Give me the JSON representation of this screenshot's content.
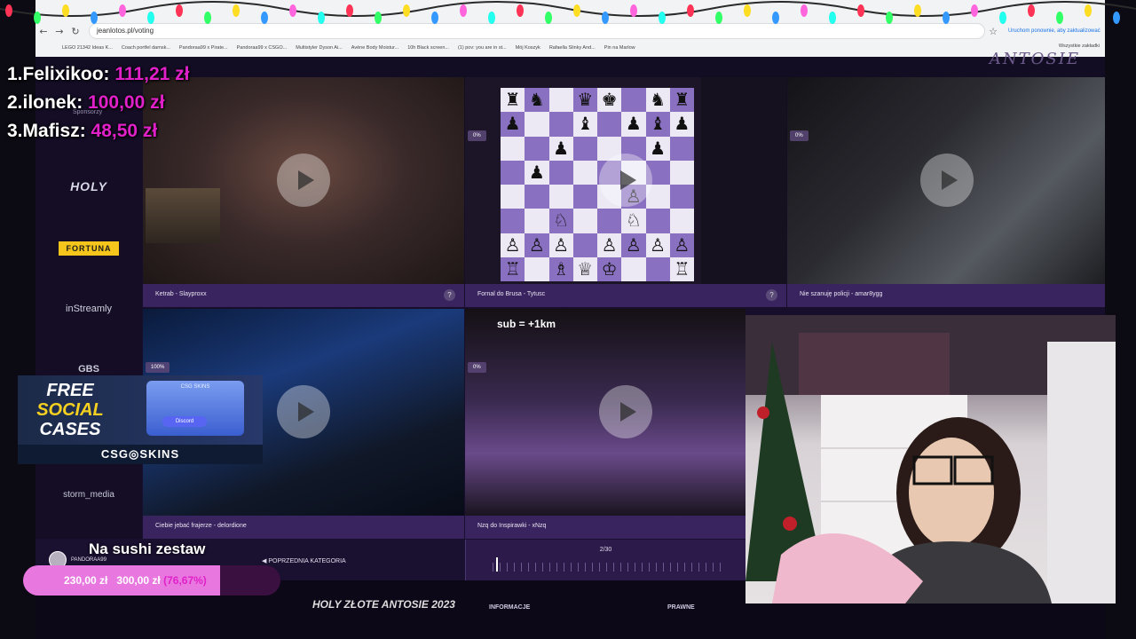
{
  "browser": {
    "url": "jeanlotos.pl/voting",
    "update_note": "Uruchom ponownie, aby zaktualizować",
    "all_bookmarks": "Wszystkie zakładki",
    "bookmarks": [
      "LEGO 21342 Ideas K...",
      "Coach portfel damsk...",
      "Pandoraa99 x Pirate...",
      "Pandoraa99 x CSGO...",
      "Multistyler Dyson Ai...",
      "Avène Body Moistur...",
      "10h Black screen...",
      "(1) pov: you are in st...",
      "Mój Koszyk",
      "Rafaella Slinky And...",
      "Pin na Marlow"
    ]
  },
  "site": {
    "brand_top": "ANTOSIE",
    "sponsors_heading": "Sponsorzy",
    "sponsors": {
      "holy": "HOLY",
      "fortuna": "FORTUNA",
      "instreamly": "inStreamly",
      "gbs": "GBS",
      "storm": "storm_media"
    },
    "tiles": [
      {
        "caption": "Ketrab - Slayproxx",
        "badge": ""
      },
      {
        "caption": "Fornal do Brusa - Tytusc",
        "badge": "0%"
      },
      {
        "caption": "Nie szanuję policji - amar8ygg",
        "badge": "0%"
      },
      {
        "caption": "Ciebie jebać frajerze - delordione",
        "badge": "100%"
      },
      {
        "caption": "Nzq do Inspirawki - xNzq",
        "badge": "0%",
        "overlay": "sub = +1km"
      }
    ],
    "prev_category": "POPRZEDNIA KATEGORIA",
    "page_indicator": "2/30",
    "footer": {
      "logo": "HOLY ZŁOTE ANTOSIE 2023",
      "info": "INFORMACJE",
      "legal": "PRAWNE"
    }
  },
  "leaderboard": [
    {
      "rank": "1.",
      "name": "Felixikoo:",
      "amount": "111,21 zł"
    },
    {
      "rank": "2.",
      "name": "ilonek:",
      "amount": "100,00 zł"
    },
    {
      "rank": "3.",
      "name": "Mafisz:",
      "amount": "48,50 zł"
    }
  ],
  "ad": {
    "line1": "FREE",
    "line2": "SOCIAL",
    "line3": "CASES",
    "box_label": "CSG SKINS",
    "discord": "Discord",
    "brand": "CSG◎SKINS"
  },
  "goal": {
    "title": "Na sushi zestaw",
    "user": "PANDORAA99",
    "current": "230,00 zł",
    "target": "300,00 zł",
    "percent_label": "(76,67%)",
    "fraction": 0.7667
  },
  "chess": {
    "rows": [
      [
        "♜",
        "♞",
        "",
        "♛",
        "♚",
        "",
        "♞",
        "♜"
      ],
      [
        "♟",
        "",
        "",
        "♝",
        "",
        "♟",
        "♝",
        "♟"
      ],
      [
        "",
        "",
        "♟",
        "",
        "",
        "",
        "♟",
        ""
      ],
      [
        "",
        "♟",
        "",
        "",
        "",
        "",
        "",
        ""
      ],
      [
        "",
        "",
        "",
        "",
        "",
        "♙",
        "",
        ""
      ],
      [
        "",
        "",
        "♘",
        "",
        "",
        "♘",
        "",
        ""
      ],
      [
        "♙",
        "♙",
        "♙",
        "",
        "♙",
        "♙",
        "♙",
        "♙"
      ],
      [
        "♖",
        "",
        "♗",
        "♕",
        "♔",
        "",
        "",
        "♖"
      ]
    ]
  }
}
